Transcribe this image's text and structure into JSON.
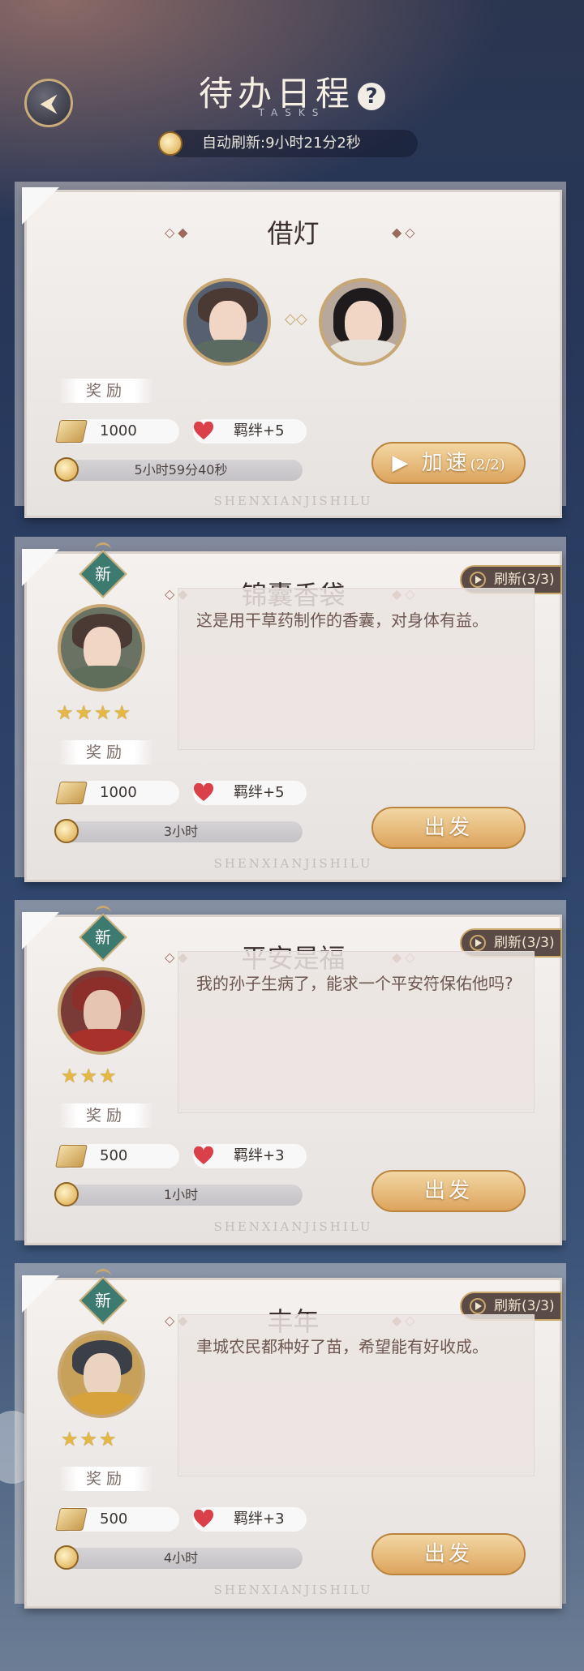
{
  "header": {
    "title": "待办日程",
    "subtitle": "TASKS",
    "help_symbol": "?",
    "back_symbol": "⮜",
    "refresh_text": "自动刷新:9小时21分2秒"
  },
  "tasks": [
    {
      "title": "借灯",
      "reward_label": "奖励",
      "coins": "1000",
      "bond": "羁绊+5",
      "timer": "5小时59分40秒",
      "button_main": "▶ 加速",
      "button_sub": "(2/2)",
      "watermark": "SHENXIANJISHILU"
    },
    {
      "title": "锦囊香袋",
      "new_badge": "新",
      "refresh": "刷新(3/3)",
      "description": "这是用干草药制作的香囊，对身体有益。",
      "stars": "★★★★",
      "reward_label": "奖励",
      "coins": "1000",
      "bond": "羁绊+5",
      "timer": "3小时",
      "button": "出发",
      "watermark": "SHENXIANJISHILU"
    },
    {
      "title": "平安是福",
      "new_badge": "新",
      "refresh": "刷新(3/3)",
      "description": "我的孙子生病了，能求一个平安符保佑他吗?",
      "stars": "★★★",
      "reward_label": "奖励",
      "coins": "500",
      "bond": "羁绊+3",
      "timer": "1小时",
      "button": "出发",
      "watermark": "SHENXIANJISHILU"
    },
    {
      "title": "丰年",
      "new_badge": "新",
      "refresh": "刷新(3/3)",
      "description": "聿城农民都种好了苗，希望能有好收成。",
      "stars": "★★★",
      "reward_label": "奖励",
      "coins": "500",
      "bond": "羁绊+3",
      "timer": "4小时",
      "button": "出发",
      "watermark": "SHENXIANJISHILU"
    }
  ],
  "colors": {
    "gold_button": "#dca45d",
    "new_badge": "#3d7a70",
    "refresh_tag": "#5a4b47",
    "star": "#e5b843"
  },
  "icons": [
    "back-arrow-icon",
    "help-icon",
    "clock-icon",
    "coin-icon",
    "heart-icon",
    "play-icon",
    "link-icon",
    "new-badge-icon"
  ]
}
